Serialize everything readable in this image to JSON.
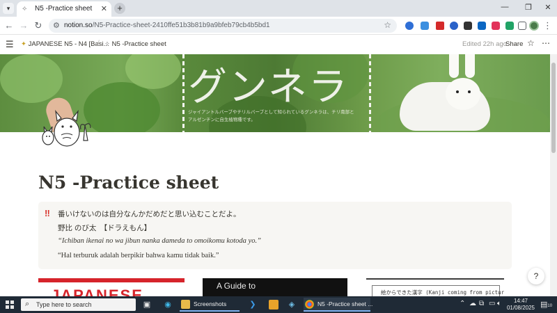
{
  "browser": {
    "tab_title": "N5 -Practice sheet",
    "url_host": "notion.so",
    "url_path": "/N5-Practice-sheet-2410ffe51b3b81b9a9bfeb79cb4b5bd1",
    "tab_close": "✕",
    "new_tab": "+",
    "win_min": "—",
    "win_max": "❐",
    "win_close": "✕"
  },
  "notion": {
    "breadcrumb_parent": "JAPANESE N5 - N4 [Basi...",
    "breadcrumb_sep": "/",
    "breadcrumb_current": "N5 -Practice sheet",
    "edited": "Edited 22h ago",
    "share": "Share",
    "cover_title": "グンネラ",
    "cover_note": "ジャイアントルバーブやチリルバーブとして知られているグンネラは、チリ南部とアルゼンチンに自生植物種です。",
    "page_title": "N5 -Practice sheet",
    "callout": {
      "icon": "‼",
      "line1": "番いけないのは自分なんかだめだと思い込むことだよ。",
      "line2": "野比 のび太　【ドラえもん】",
      "line3": "“Ichiban ikenai no wa jibun nanka dameda to omoikomu kotoda yo.”",
      "line4": "“Hal terburuk adalah berpikir bahwa kamu tidak baik.”"
    },
    "thumbs": {
      "t1": "JAPANESE",
      "t2": "A Guide to",
      "t3": "絵からできた漢字 (Kanji coming from pictures)"
    }
  },
  "taskbar": {
    "search_placeholder": "Type here to search",
    "apps": [
      {
        "label": "Screenshots"
      },
      {
        "label": "N5 -Practice sheet ..."
      }
    ],
    "time": "14:47",
    "date": "01/08/2025",
    "notif_count": "10"
  },
  "colors": {
    "accent_red": "#d8332b",
    "text": "#37352f",
    "callout_bg": "#f7f6f3"
  }
}
